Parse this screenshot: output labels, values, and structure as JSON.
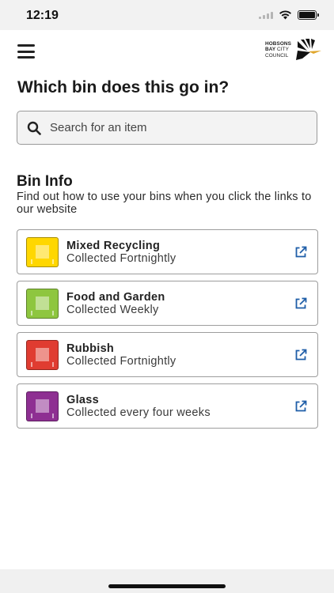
{
  "status": {
    "time": "12:19"
  },
  "header": {
    "logo": {
      "line1": "HOBSONS",
      "line2a": "BAY",
      "line2b": "CITY",
      "line3": "COUNCIL"
    }
  },
  "page": {
    "title": "Which bin does this go in?"
  },
  "search": {
    "placeholder": "Search for an item"
  },
  "bin_info": {
    "title": "Bin Info",
    "description": "Find out how to use your bins when you click the links to our website",
    "bins": [
      {
        "name": "Mixed Recycling",
        "frequency": "Collected Fortnightly",
        "color": "#ffd700"
      },
      {
        "name": "Food and Garden",
        "frequency": "Collected Weekly",
        "color": "#8ec63f"
      },
      {
        "name": "Rubbish",
        "frequency": "Collected Fortnightly",
        "color": "#e03c31"
      },
      {
        "name": "Glass",
        "frequency": "Collected every four weeks",
        "color": "#8e2f92"
      }
    ]
  },
  "colors": {
    "link_icon": "#1f5ea8"
  }
}
